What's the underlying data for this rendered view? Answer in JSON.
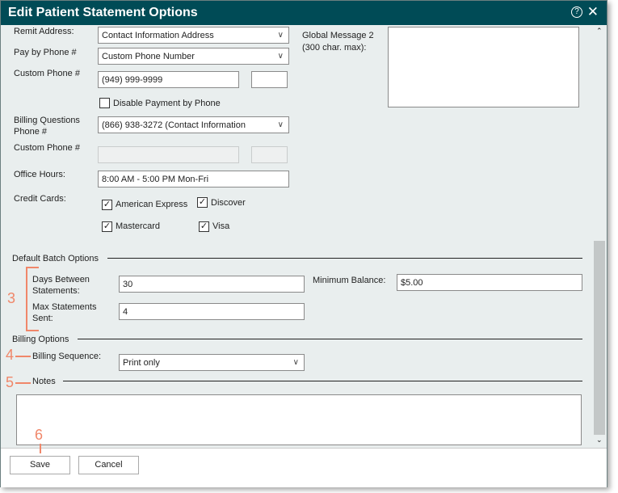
{
  "window": {
    "title": "Edit Patient Statement Options",
    "help_icon": "?",
    "close_icon": "✕"
  },
  "form": {
    "remit_address": {
      "label": "Remit Address:",
      "value": "Contact Information Address"
    },
    "pay_by_phone": {
      "label": "Pay by Phone #",
      "value": "Custom Phone Number"
    },
    "custom_phone": {
      "label": "Custom Phone #",
      "value": "(949) 999-9999",
      "ext": ""
    },
    "disable_payment": {
      "label": "Disable Payment by Phone",
      "checked": false
    },
    "billing_questions": {
      "label": "Billing Questions Phone #",
      "value": "(866) 938-3272 (Contact Information"
    },
    "custom_phone2": {
      "label": "Custom Phone #",
      "value": ""
    },
    "office_hours": {
      "label": "Office Hours:",
      "value": "8:00 AM - 5:00 PM Mon-Fri"
    },
    "credit_cards": {
      "label": "Credit Cards:",
      "cards": [
        {
          "label": "American Express",
          "checked": true
        },
        {
          "label": "Discover",
          "checked": true
        },
        {
          "label": "Mastercard",
          "checked": true
        },
        {
          "label": "Visa",
          "checked": true
        }
      ]
    },
    "global_message": {
      "label1": "Global Message 2",
      "label2": "(300 char. max):",
      "value": ""
    }
  },
  "batch": {
    "title": "Default Batch Options",
    "days_label1": "Days Between",
    "days_label2": "Statements:",
    "days": "30",
    "max_label1": "Max Statements",
    "max_label2": "Sent:",
    "max": "4",
    "min_label": "Minimum Balance:",
    "min": "$5.00"
  },
  "billing": {
    "title": "Billing Options",
    "seq_label": "Billing Sequence:",
    "seq": "Print only"
  },
  "notes": {
    "title": "Notes",
    "value": ""
  },
  "annotations": [
    "3",
    "4",
    "5",
    "6"
  ],
  "footer": {
    "save": "Save",
    "cancel": "Cancel"
  }
}
